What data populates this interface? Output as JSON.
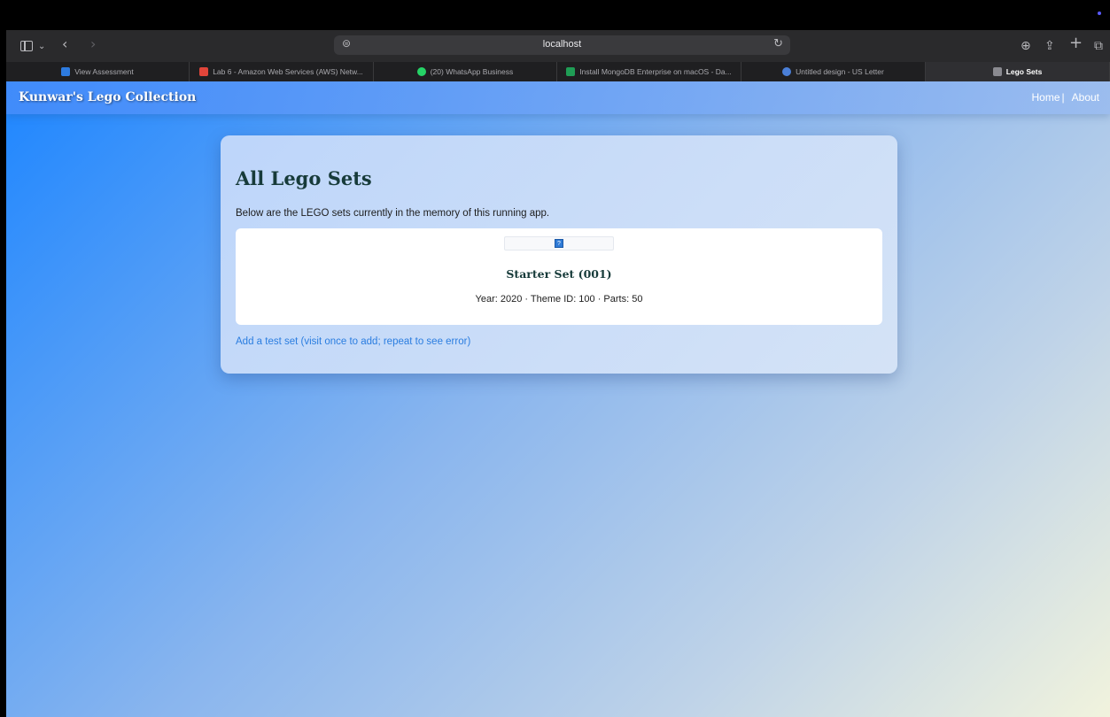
{
  "browser": {
    "url": "localhost",
    "tabs": [
      {
        "label": "View Assessment",
        "favicon_color": "#2d7be0",
        "active": false
      },
      {
        "label": "Lab 6 - Amazon Web Services (AWS) Netw...",
        "favicon_color": "#e0453a",
        "active": false
      },
      {
        "label": "(20) WhatsApp Business",
        "favicon_color": "#25d366",
        "active": false
      },
      {
        "label": "Install MongoDB Enterprise on macOS - Da...",
        "favicon_color": "#1f9d55",
        "active": false
      },
      {
        "label": "Untitled design - US Letter",
        "favicon_color": "#4a7fd8",
        "active": false
      },
      {
        "label": "Lego Sets",
        "favicon_color": "#8a8a90",
        "active": true
      }
    ],
    "icons": {
      "sidebar": "sidebar-icon",
      "back": "‹",
      "forward": "›",
      "chevron": "⌄",
      "site_settings": "⊜",
      "reload": "↻",
      "download": "⊕",
      "share": "⇪",
      "new_tab": "+",
      "tab_overview": "⧉"
    }
  },
  "navbar": {
    "brand": "Kunwar's Lego Collection",
    "links": {
      "home": "Home",
      "separator": "|",
      "about": "About"
    }
  },
  "main": {
    "title": "All Lego Sets",
    "subtitle": "Below are the LEGO sets currently in the memory of this running app.",
    "sets": [
      {
        "name": "Starter Set (001)",
        "meta": "Year: 2020 · Theme ID: 100 · Parts: 50",
        "image_icon": "?"
      }
    ],
    "add_link": "Add a test set (visit once to add; repeat to see error)"
  },
  "colors": {
    "accent_link": "#2a7de0",
    "heading": "#173b3a",
    "gradient_start": "#1e86ff",
    "gradient_end": "#f1f3dd"
  }
}
